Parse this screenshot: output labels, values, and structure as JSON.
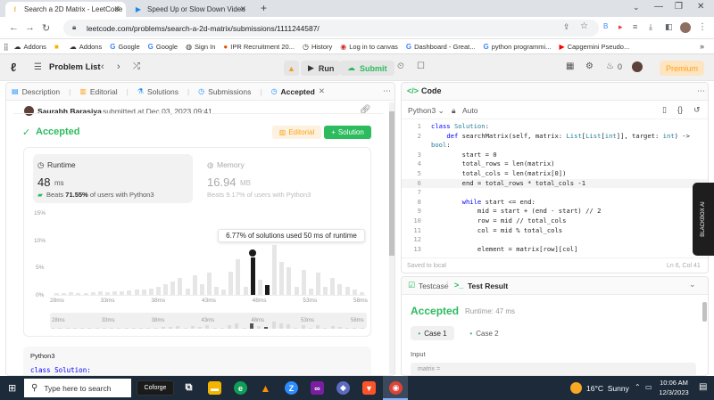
{
  "browser": {
    "tabs": [
      {
        "title": "Search a 2D Matrix - LeetCode",
        "active": true
      },
      {
        "title": "Speed Up or Slow Down Video",
        "active": false
      }
    ],
    "new_tab": "+",
    "url": "leetcode.com/problems/search-a-2d-matrix/submissions/1111244587/",
    "bookmarks": [
      "Addons",
      "Addons",
      "Google",
      "Google",
      "Sign In",
      "IPR Recruitment 20...",
      "History",
      "Log in to canvas",
      "Dashboard - Great...",
      "python programmi...",
      "Capgemini Pseudo..."
    ]
  },
  "lc_nav": {
    "problem_list": "Problem List",
    "run": "Run",
    "submit": "Submit",
    "fire_count": "0",
    "premium": "Premium"
  },
  "left": {
    "tabs": [
      "Description",
      "Editorial",
      "Solutions",
      "Submissions",
      "Accepted"
    ],
    "user": "Saurabh Barasiya",
    "submitted_text": "submitted at Dec 03, 2023 09:41",
    "status": "Accepted",
    "editorial_btn": "Editorial",
    "solution_btn": "Solution",
    "runtime": {
      "label": "Runtime",
      "value": "48",
      "unit": "ms",
      "beats_pre": "Beats",
      "beats_pct": "71.55%",
      "beats_post": "of users with Python3"
    },
    "memory": {
      "label": "Memory",
      "value": "16.94",
      "unit": "MB",
      "beats_text": "Beats 9.17% of users with Python3"
    },
    "tooltip": "6.77% of solutions used 50 ms of runtime",
    "language": "Python3",
    "code_peek": "class Solution:"
  },
  "chart_data": {
    "type": "bar",
    "yticks": [
      "15%",
      "10%",
      "5%",
      "0%"
    ],
    "xticks": [
      "28ms",
      "33ms",
      "38ms",
      "43ms",
      "48ms",
      "53ms",
      "58ms"
    ],
    "ylim": [
      0,
      15
    ],
    "highlight": "48ms",
    "values": [
      0.3,
      0.4,
      0.5,
      0.3,
      0.4,
      0.5,
      0.6,
      0.5,
      0.7,
      0.6,
      0.8,
      0.9,
      1.0,
      1.2,
      1.5,
      2.0,
      2.5,
      3.0,
      1.2,
      3.5,
      2.0,
      4.0,
      1.5,
      1.0,
      4.2,
      6.5,
      1.5,
      6.77,
      2.8,
      1.8,
      9.0,
      6.0,
      5.0,
      1.5,
      4.5,
      1.2,
      4.0,
      1.5,
      3.0,
      2.0,
      1.5,
      1.0,
      0.5
    ]
  },
  "right": {
    "title": "Code",
    "language": "Python3",
    "mode": "Auto",
    "code_lines": [
      {
        "n": "1",
        "t": "class Solution:"
      },
      {
        "n": "2",
        "t": "    def searchMatrix(self, matrix: List[List[int]], target: int) ->"
      },
      {
        "n": "",
        "t": "bool:"
      },
      {
        "n": "3",
        "t": "        start = 0"
      },
      {
        "n": "4",
        "t": "        total_rows = len(matrix)"
      },
      {
        "n": "5",
        "t": "        total_cols = len(matrix[0])"
      },
      {
        "n": "6",
        "t": "        end = total_rows * total_cols -1"
      },
      {
        "n": "7",
        "t": ""
      },
      {
        "n": "8",
        "t": "        while start <= end:"
      },
      {
        "n": "9",
        "t": "            mid = start + (end - start) // 2"
      },
      {
        "n": "10",
        "t": "            row = mid // total_cols"
      },
      {
        "n": "11",
        "t": "            col = mid % total_cols"
      },
      {
        "n": "12",
        "t": ""
      },
      {
        "n": "13",
        "t": "            element = matrix[row][col]"
      }
    ],
    "saved": "Saved to local",
    "cursor": "Ln 6, Col 41",
    "testcase": "Testcase",
    "test_result": "Test Result",
    "result_status": "Accepted",
    "result_runtime": "Runtime: 47 ms",
    "cases": [
      "Case 1",
      "Case 2"
    ],
    "input_label": "Input",
    "input_value": "matrix ="
  },
  "blackbox": "BLACKBOX AI",
  "taskbar": {
    "search_placeholder": "Type here to search",
    "weather": "16°C  Sunny",
    "time": "10:06 AM",
    "date": "12/3/2023"
  },
  "colors": {
    "accent": "#2cbb5d",
    "dark_bar": "#1a1a1a",
    "premium": "#ffa116",
    "taskbar": "#1c2a3a"
  }
}
